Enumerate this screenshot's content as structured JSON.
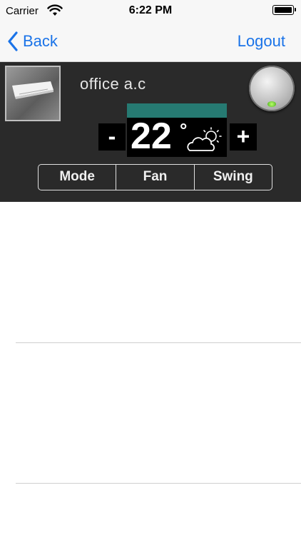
{
  "status_bar": {
    "carrier": "Carrier",
    "time": "6:22 PM",
    "wifi_icon": "wifi-icon",
    "battery_icon": "battery-icon"
  },
  "nav": {
    "back_label": "Back",
    "logout_label": "Logout",
    "accent_color": "#1a73e8"
  },
  "device": {
    "name": "office a.c",
    "temperature": "22",
    "degree_symbol": "°",
    "minus_label": "-",
    "plus_label": "+",
    "modes": [
      "Mode",
      "Fan",
      "Swing"
    ],
    "panel_color": "#2a2a2a",
    "temp_bar_color": "#267a72"
  }
}
